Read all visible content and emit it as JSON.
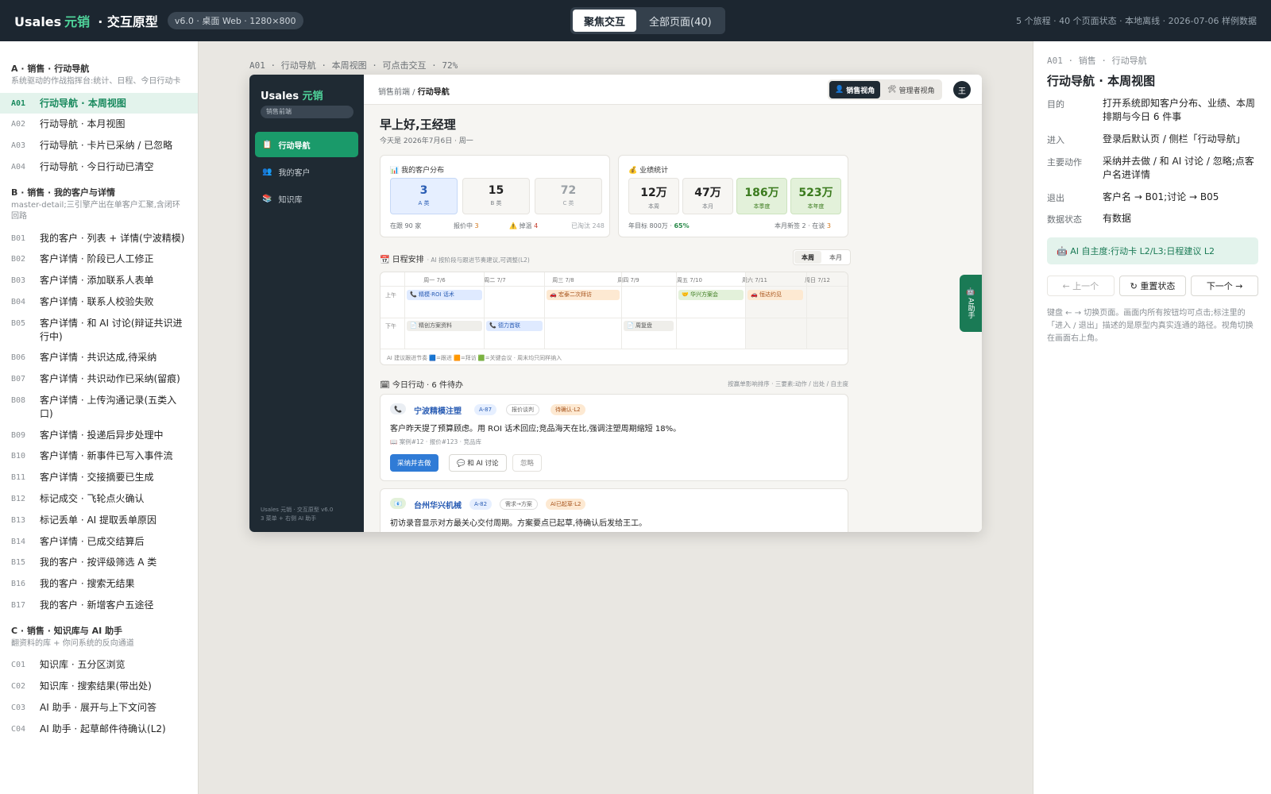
{
  "topbar": {
    "brand": "Usales",
    "brand_accent": "元销",
    "brand_sub": "· 交互原型",
    "version": "v6.0 · 桌面 Web · 1280×800",
    "tabs": [
      "聚焦交互",
      "全部页面(40)"
    ],
    "meta": "5 个旅程 · 40 个页面状态 · 本地离线 · 2026-07-06 样例数据"
  },
  "leftnav": {
    "groups": [
      {
        "title": "A · 销售 · 行动导航",
        "desc": "系统驱动的作战指挥台:统计、日程、今日行动卡",
        "items": [
          {
            "code": "A01",
            "label": "行动导航 · 本周视图"
          },
          {
            "code": "A02",
            "label": "行动导航 · 本月视图"
          },
          {
            "code": "A03",
            "label": "行动导航 · 卡片已采纳 / 已忽略"
          },
          {
            "code": "A04",
            "label": "行动导航 · 今日行动已清空"
          }
        ]
      },
      {
        "title": "B · 销售 · 我的客户与详情",
        "desc": "master-detail;三引擎产出在单客户汇聚,含闭环回路",
        "items": [
          {
            "code": "B01",
            "label": "我的客户 · 列表 + 详情(宁波精模)"
          },
          {
            "code": "B02",
            "label": "客户详情 · 阶段已人工修正"
          },
          {
            "code": "B03",
            "label": "客户详情 · 添加联系人表单"
          },
          {
            "code": "B04",
            "label": "客户详情 · 联系人校验失败"
          },
          {
            "code": "B05",
            "label": "客户详情 · 和 AI 讨论(辩证共识进行中)"
          },
          {
            "code": "B06",
            "label": "客户详情 · 共识达成,待采纳"
          },
          {
            "code": "B07",
            "label": "客户详情 · 共识动作已采纳(留痕)"
          },
          {
            "code": "B08",
            "label": "客户详情 · 上传沟通记录(五类入口)"
          },
          {
            "code": "B09",
            "label": "客户详情 · 投递后异步处理中"
          },
          {
            "code": "B10",
            "label": "客户详情 · 新事件已写入事件流"
          },
          {
            "code": "B11",
            "label": "客户详情 · 交接摘要已生成"
          },
          {
            "code": "B12",
            "label": "标记成交 · 飞轮点火确认"
          },
          {
            "code": "B13",
            "label": "标记丢单 · AI 提取丢单原因"
          },
          {
            "code": "B14",
            "label": "客户详情 · 已成交结算后"
          },
          {
            "code": "B15",
            "label": "我的客户 · 按评级筛选 A 类"
          },
          {
            "code": "B16",
            "label": "我的客户 · 搜索无结果"
          },
          {
            "code": "B17",
            "label": "我的客户 · 新增客户五途径"
          }
        ]
      },
      {
        "title": "C · 销售 · 知识库与 AI 助手",
        "desc": "翻资料的库 + 你问系统的反向通道",
        "items": [
          {
            "code": "C01",
            "label": "知识库 · 五分区浏览"
          },
          {
            "code": "C02",
            "label": "知识库 · 搜索结果(带出处)"
          },
          {
            "code": "C03",
            "label": "AI 助手 · 展开与上下文问答"
          },
          {
            "code": "C04",
            "label": "AI 助手 · 起草邮件待确认(L2)"
          }
        ]
      }
    ]
  },
  "crumbs": "A01 · 行动导航 · 本周视图 · 可点击交互 · 72%",
  "app": {
    "brand": "Usales",
    "brand_accent": "元销",
    "pill": "销售前端",
    "nav": [
      {
        "icon": "📋",
        "label": "行动导航"
      },
      {
        "icon": "👥",
        "label": "我的客户"
      },
      {
        "icon": "📚",
        "label": "知识库"
      }
    ],
    "side_foot_1": "Usales 元销 · 交互原型 v6.0",
    "side_foot_2": "3 菜单 + 右侧 AI 助手",
    "bc_prefix": "销售前端 /",
    "bc_current": "行动导航",
    "roles": [
      {
        "icon": "👤",
        "label": "销售视角"
      },
      {
        "icon": "🛠",
        "label": "管理者视角"
      }
    ],
    "avatar": "王",
    "greeting": "早上好,王经理",
    "date_line": "今天是 2026年7月6日 · 周一",
    "dist": {
      "title": "📊 我的客户分布",
      "stats": [
        {
          "value": "3",
          "label": "A 类"
        },
        {
          "value": "15",
          "label": "B 类"
        },
        {
          "value": "72",
          "label": "C 类"
        }
      ],
      "f1": "在跟 90 家",
      "f2_pre": "报价中",
      "f2_val": "3",
      "f3_pre": "⚠️ 掉温",
      "f3_val": "4",
      "f4": "已淘汰 248"
    },
    "perf": {
      "title": "💰 业绩统计",
      "stats": [
        {
          "value": "12万",
          "label": "本周"
        },
        {
          "value": "47万",
          "label": "本月"
        },
        {
          "value": "186万",
          "label": "本季度"
        },
        {
          "value": "523万",
          "label": "本年度"
        }
      ],
      "f1_pre": "年目标 800万 ·",
      "f1_val": "65%",
      "f2_pre": "本月新签 2 · 在谈",
      "f2_val": "3"
    },
    "sched": {
      "title": "📆 日程安排",
      "hint": "· AI 按阶段与跟进节奏建议,可调整(L2)",
      "toggle": [
        "本周",
        "本月"
      ],
      "days": [
        "周一 7/6",
        "周二 7/7",
        "周三 7/8",
        "周四 7/9",
        "周五 7/10",
        "周六 7/11",
        "周日 7/12"
      ],
      "am": "上午",
      "pm": "下午",
      "events": [
        {
          "label": "📞 精模·ROI 话术",
          "color": "blue"
        },
        {
          "label": "🚗 宏泰二次拜访",
          "color": "orange"
        },
        {
          "label": "🤝 华兴方案会",
          "color": "green"
        },
        {
          "label": "🚗 恒达约见",
          "color": "orange"
        },
        {
          "label": "📄 精创方案资料",
          "color": "gray"
        },
        {
          "label": "📞 德力首联",
          "color": "blue"
        },
        {
          "label": "📄 周复盘",
          "color": "gray"
        }
      ],
      "legend": "AI 建议跟进节奏 🟦=跟进 🟧=拜访 🟩=关键会议 · 周末均只同样纳入"
    },
    "actions": {
      "title": "🗓 今日行动 · 6 件待办",
      "right": "按赢单影响排序 · 三要素:动作 / 出处 / 自主度",
      "cards": [
        {
          "icon": "📞",
          "name": "宁波精模注塑",
          "tags": [
            "A-87",
            "报价谈判",
            "待确认·L2"
          ],
          "text": "客户昨天提了预算顾虑。用 ROI 话术回应;竞品海天在比,强调注塑周期缩短 18%。",
          "refs": "📖 案例#12 · 报价#123 · 竞品库",
          "buttons": [
            "采纳并去做",
            "💬 和 AI 讨论",
            "忽略"
          ]
        },
        {
          "icon": "📧",
          "name": "台州华兴机械",
          "tags": [
            "A-82",
            "需求→方案",
            "AI已起草·L2"
          ],
          "text": "初访录音显示对方最关心交付周期。方案要点已起草,待确认后发给王工。"
        }
      ]
    },
    "ai_tab_icon": "🤖",
    "ai_tab_label": "AI助手"
  },
  "rpanel": {
    "crumb": "A01 · 销售 · 行动导航",
    "title": "行动导航 · 本周视图",
    "rows": [
      {
        "k": "目的",
        "v": "打开系统即知客户分布、业绩、本周排期与今日 6 件事"
      },
      {
        "k": "进入",
        "v": "登录后默认页 / 侧栏「行动导航」"
      },
      {
        "k": "主要动作",
        "v": "采纳并去做 / 和 AI 讨论 / 忽略;点客户名进详情"
      },
      {
        "k": "退出",
        "v": "客户名 → B01;讨论 → B05"
      },
      {
        "k": "数据状态",
        "v": "有数据"
      }
    ],
    "ai_note": "🤖 AI 自主度:行动卡 L2/L3;日程建议 L2",
    "btn_prev": "← 上一个",
    "btn_reset": "↻ 重置状态",
    "btn_next": "下一个 →",
    "note": "键盘 ← → 切换页面。画面内所有按钮均可点击;标注里的「进入 / 退出」描述的是原型内真实连通的路径。视角切换在画面右上角。"
  }
}
